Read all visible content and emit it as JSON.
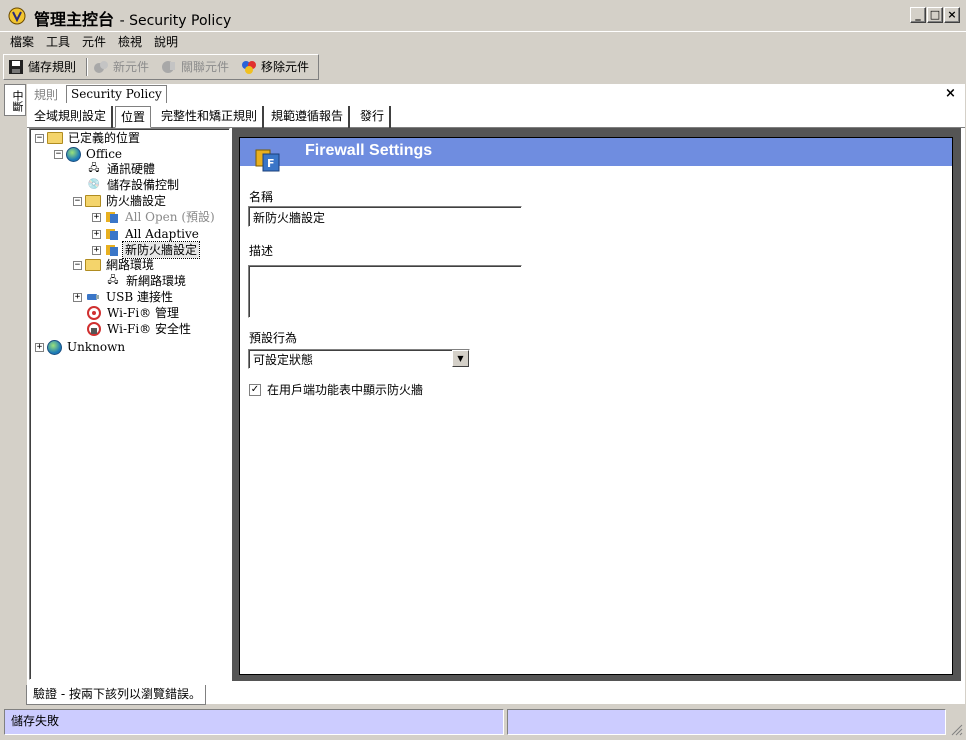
{
  "window": {
    "title": "管理主控台",
    "subtitle": "- Security Policy",
    "controls": [
      "_",
      "□",
      "×"
    ]
  },
  "menu": [
    "檔案",
    "工具",
    "元件",
    "檢視",
    "說明"
  ],
  "toolbar": {
    "save": "儲存規則",
    "new": "新元件",
    "associate": "關聯元件",
    "remove": "移除元件"
  },
  "side_tab": "中斷",
  "doc_tabs": {
    "rules": "規則",
    "policy": "Security Policy",
    "close": "×"
  },
  "page_tabs": [
    "全域規則設定",
    "位置",
    "完整性和矯正規則",
    "規範遵循報告",
    "發行"
  ],
  "tree": {
    "root": "已定義的位置",
    "office": "Office",
    "comm_hw": "通訊硬體",
    "storage": "儲存設備控制",
    "firewall": "防火牆設定",
    "fw_items": [
      "All Open (預設)",
      "All Adaptive",
      "新防火牆設定"
    ],
    "network": "網路環境",
    "new_network": "新網路環境",
    "usb": "USB 連接性",
    "wifi_mgmt": "Wi-Fi® 管理",
    "wifi_sec": "Wi-Fi® 安全性",
    "unknown": "Unknown"
  },
  "panel": {
    "title": "Firewall Settings",
    "name_label": "名稱",
    "name_value": "新防火牆設定",
    "desc_label": "描述",
    "desc_value": "",
    "default_label": "預設行為",
    "default_value": "可設定狀態",
    "checkbox_label": "在用戶端功能表中顯示防火牆",
    "checkbox_checked": true
  },
  "validation_tab": "驗證 - 按兩下該列以瀏覽錯誤。",
  "status": {
    "left": "儲存失敗",
    "right": ""
  },
  "colors": {
    "header_blue": "#6f8de0",
    "status_lavender": "#ccccff",
    "chrome": "#d4d0c8"
  }
}
